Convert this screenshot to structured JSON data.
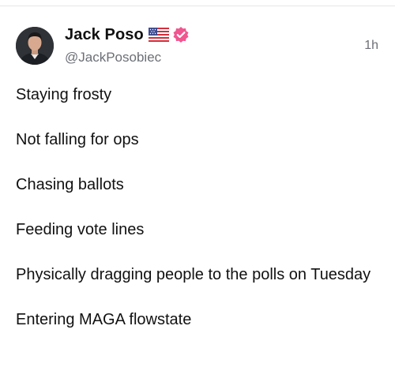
{
  "author": {
    "name": "Jack Poso",
    "handle": "@JackPosobiec",
    "flag_icon": "us-flag-icon",
    "verified_icon": "verified-badge-icon",
    "verified_color": "#f0568f"
  },
  "post": {
    "timestamp": "1h",
    "lines": [
      "Staying frosty",
      "Not falling for ops",
      "Chasing ballots",
      "Feeding vote lines",
      "Physically dragging people to the polls on Tuesday",
      "Entering MAGA flowstate"
    ]
  }
}
